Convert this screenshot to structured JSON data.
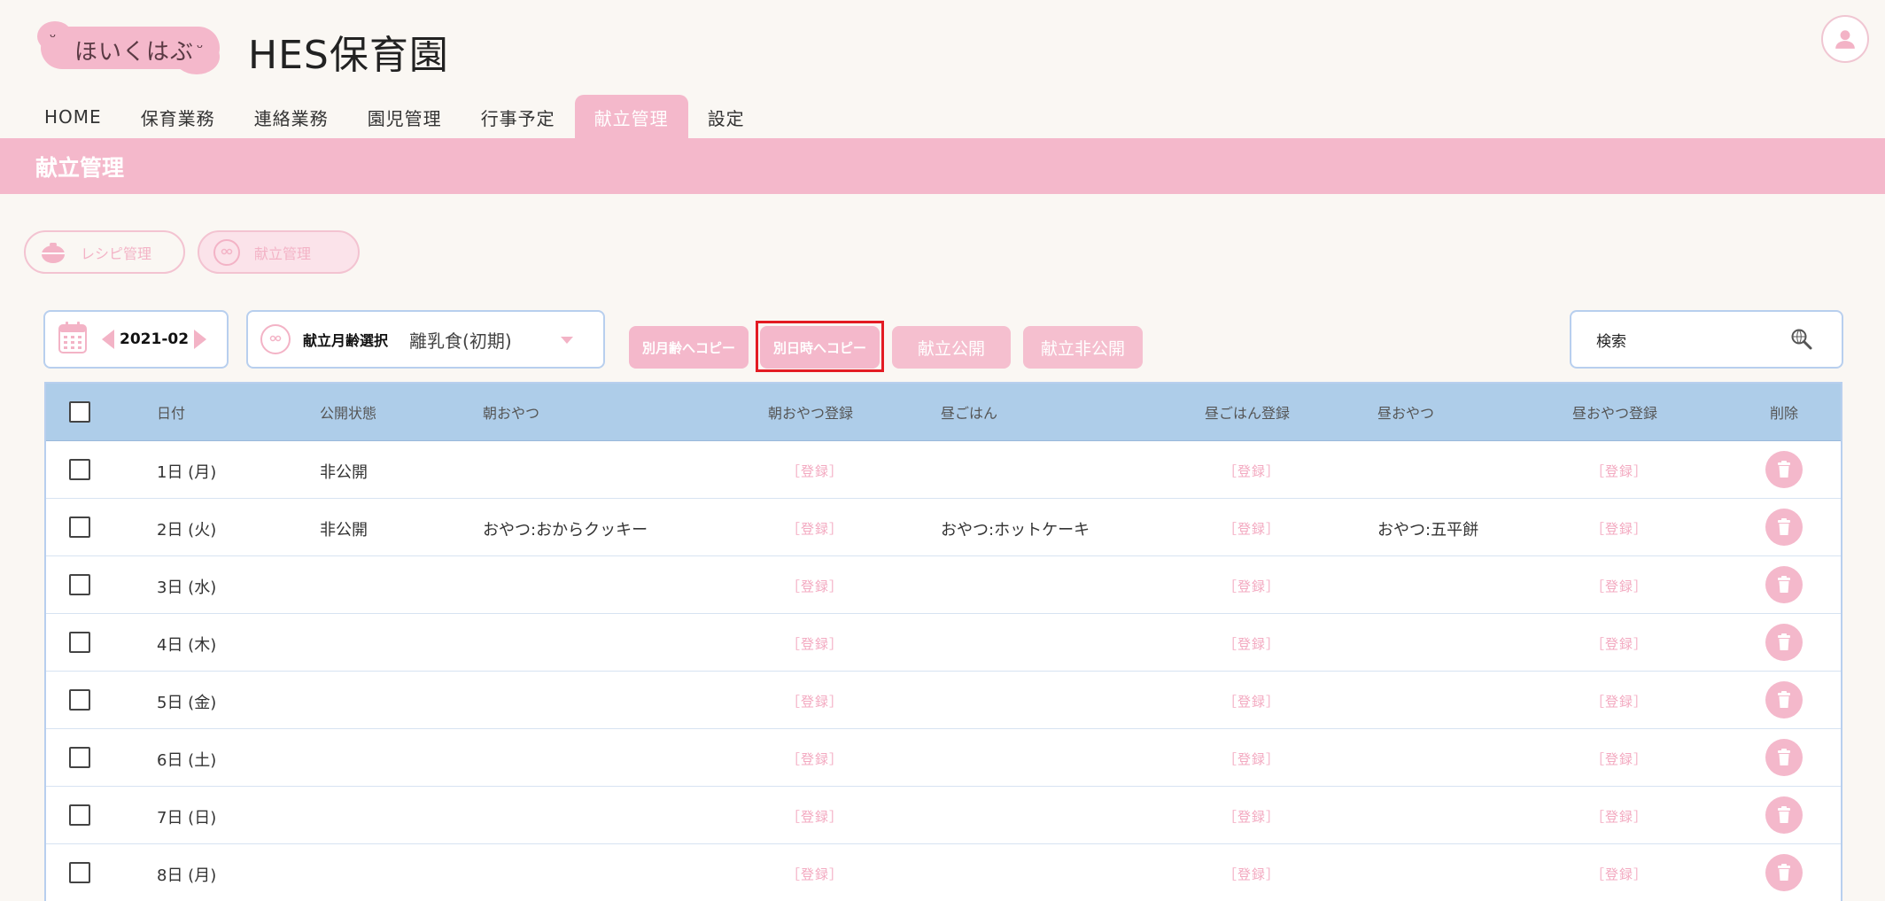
{
  "header": {
    "logo_text": "ほいくはぶ",
    "app_title": "HES保育園"
  },
  "nav": {
    "items": [
      {
        "label": "HOME",
        "active": false
      },
      {
        "label": "保育業務",
        "active": false
      },
      {
        "label": "連絡業務",
        "active": false
      },
      {
        "label": "園児管理",
        "active": false
      },
      {
        "label": "行事予定",
        "active": false
      },
      {
        "label": "献立管理",
        "active": true
      },
      {
        "label": "設定",
        "active": false
      }
    ]
  },
  "page": {
    "title": "献立管理"
  },
  "subtabs": [
    {
      "label": "レシピ管理",
      "icon": "pot-icon"
    },
    {
      "label": "献立管理",
      "icon": "face-icon"
    }
  ],
  "toolbar": {
    "month": "2021-02",
    "age_label": "献立月齢選択",
    "age_value": "離乳食(初期)",
    "copy_age_label": "別月齢へコピー",
    "copy_date_label": "別日時へコピー",
    "publish_label": "献立公開",
    "unpublish_label": "献立非公開",
    "search_placeholder": "検索"
  },
  "colors": {
    "accent": "#f4b8cb",
    "table_header": "#aecde9",
    "highlight": "#e31b23"
  },
  "table": {
    "headers": {
      "date": "日付",
      "status": "公開状態",
      "morning_snack": "朝おやつ",
      "morning_snack_reg": "朝おやつ登録",
      "lunch": "昼ごはん",
      "lunch_reg": "昼ごはん登録",
      "afternoon_snack": "昼おやつ",
      "afternoon_snack_reg": "昼おやつ登録",
      "delete": "削除"
    },
    "register_label": "［登録］",
    "rows": [
      {
        "date": "1日 (月)",
        "status": "非公開",
        "morning": "",
        "lunch": "",
        "afternoon": ""
      },
      {
        "date": "2日 (火)",
        "status": "非公開",
        "morning": "おやつ:おからクッキー",
        "lunch": "おやつ:ホットケーキ",
        "afternoon": "おやつ:五平餅"
      },
      {
        "date": "3日 (水)",
        "status": "",
        "morning": "",
        "lunch": "",
        "afternoon": ""
      },
      {
        "date": "4日 (木)",
        "status": "",
        "morning": "",
        "lunch": "",
        "afternoon": ""
      },
      {
        "date": "5日 (金)",
        "status": "",
        "morning": "",
        "lunch": "",
        "afternoon": ""
      },
      {
        "date": "6日 (土)",
        "status": "",
        "morning": "",
        "lunch": "",
        "afternoon": ""
      },
      {
        "date": "7日 (日)",
        "status": "",
        "morning": "",
        "lunch": "",
        "afternoon": ""
      },
      {
        "date": "8日 (月)",
        "status": "",
        "morning": "",
        "lunch": "",
        "afternoon": ""
      }
    ]
  }
}
